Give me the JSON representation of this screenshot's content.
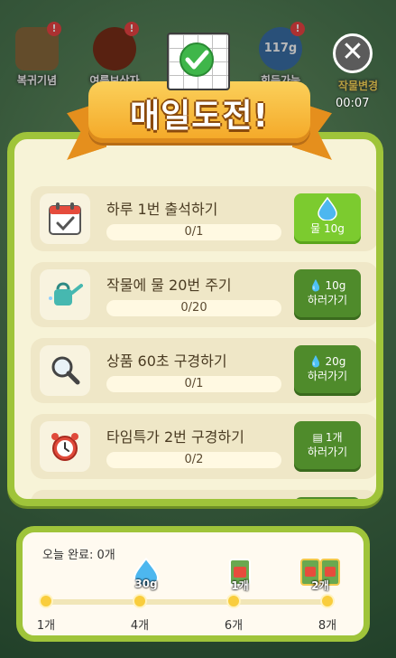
{
  "background": {
    "tiles": [
      {
        "label": "복귀기념",
        "badge": "!"
      },
      {
        "label": "여름보상자",
        "badge": "!"
      },
      {
        "label": "회득가능",
        "badge": "!",
        "amount": "117g"
      },
      {
        "label": "작물변경",
        "badge": ""
      }
    ],
    "timer": "00:07"
  },
  "header": {
    "title": "매일도전!"
  },
  "missions": [
    {
      "icon": "calendar-icon",
      "title": "하루 1번 출석하기",
      "progress": "0/1",
      "fill": 0,
      "button": {
        "line1": "",
        "line2": "물 10g",
        "state": "claim"
      }
    },
    {
      "icon": "watering-can-icon",
      "title": "작물에 물 20번 주기",
      "progress": "0/20",
      "fill": 0,
      "button": {
        "line1": "10g",
        "line2": "하러가기",
        "state": "go"
      }
    },
    {
      "icon": "magnifier-icon",
      "title": "상품 60초 구경하기",
      "progress": "0/1",
      "fill": 0,
      "button": {
        "line1": "20g",
        "line2": "하러가기",
        "state": "go"
      }
    },
    {
      "icon": "alarm-clock-icon",
      "title": "타임특가 2번 구경하기",
      "progress": "0/2",
      "fill": 0,
      "button": {
        "line1": "1개",
        "line2": "하러가기",
        "state": "go"
      }
    }
  ],
  "summary": {
    "today_label": "오늘 완료: 0개",
    "milestones": [
      {
        "label": "1개",
        "reward": ""
      },
      {
        "label": "4개",
        "reward": "30g"
      },
      {
        "label": "6개",
        "reward": "1개"
      },
      {
        "label": "8개",
        "reward": "2개"
      }
    ]
  },
  "colors": {
    "panel_border": "#9fc43a",
    "button_green": "#4f8b2b",
    "claim_green": "#7ccb2f",
    "ribbon": "#f4a726"
  }
}
